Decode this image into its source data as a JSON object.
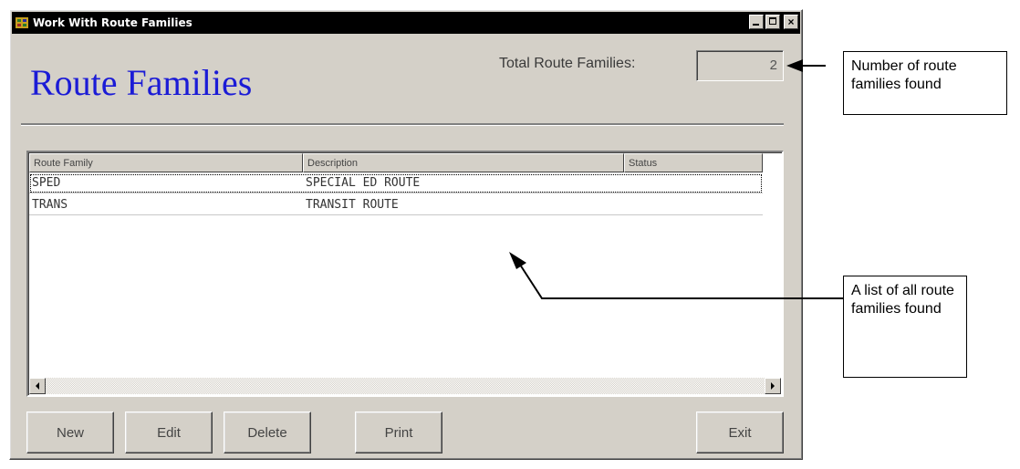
{
  "window": {
    "title": "Work With Route Families",
    "heading": "Route Families",
    "total_label": "Total Route Families:",
    "total_value": "2"
  },
  "list": {
    "columns": [
      "Route Family",
      "Description",
      "Status"
    ],
    "rows": [
      {
        "family": "SPED",
        "description": "SPECIAL ED ROUTE",
        "status": ""
      },
      {
        "family": "TRANS",
        "description": "TRANSIT ROUTE",
        "status": ""
      }
    ]
  },
  "buttons": {
    "new": "New",
    "edit": "Edit",
    "delete": "Delete",
    "print": "Print",
    "exit": "Exit"
  },
  "callouts": {
    "count": "Number of route families found",
    "list": "A list of all route families found"
  },
  "colors": {
    "heading": "#1b1bd6",
    "titlebar": "#000000",
    "face": "#d4d0c8"
  }
}
